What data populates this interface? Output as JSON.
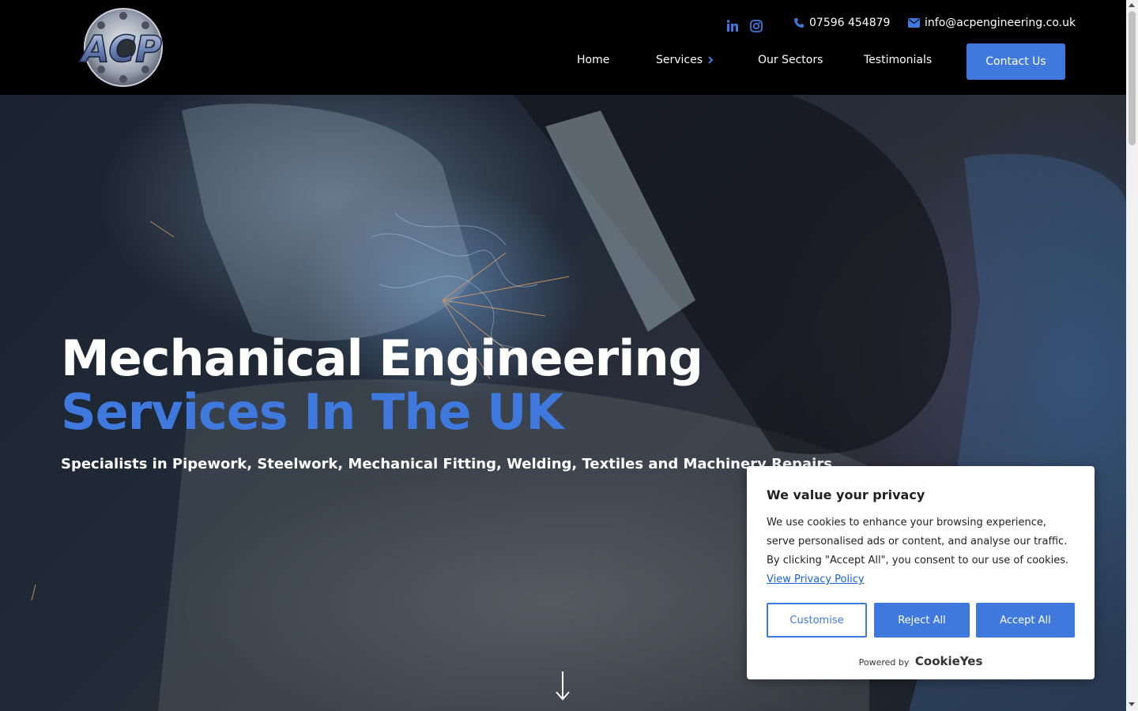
{
  "header": {
    "logo_text": "ACP",
    "phone": "07596 454879",
    "email": "info@acpengineering.co.uk",
    "social": [
      "linkedin-icon",
      "instagram-icon"
    ],
    "nav": [
      {
        "label": "Home"
      },
      {
        "label": "Services"
      },
      {
        "label": "Our Sectors"
      },
      {
        "label": "Testimonials"
      }
    ],
    "contact_label": "Contact Us"
  },
  "hero": {
    "title_line1": "Mechanical Engineering",
    "title_line2": "Services In The UK",
    "subtitle": "Specialists in Pipework, Steelwork, Mechanical Fitting, Welding, Textiles and Machinery Repairs"
  },
  "cookie": {
    "title": "We value your privacy",
    "text": "We use cookies to enhance your browsing experience, serve personalised ads or content, and analyse our traffic. By clicking \"Accept All\", you consent to our use of cookies.",
    "link": "View Privacy Policy",
    "customise": "Customise",
    "reject": "Reject All",
    "accept": "Accept All",
    "powered_by": "Powered by",
    "brand": "CookieYes"
  },
  "colors": {
    "accent": "#3f79de",
    "header_bg": "#000000"
  }
}
